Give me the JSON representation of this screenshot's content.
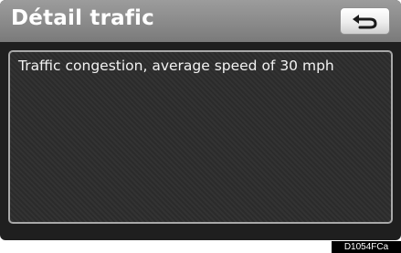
{
  "header": {
    "title": "Détail trafic",
    "back_icon": "back-arrow-icon"
  },
  "content": {
    "message": "Traffic congestion, average speed of 30 mph"
  },
  "figure_code": "D1054FCa"
}
